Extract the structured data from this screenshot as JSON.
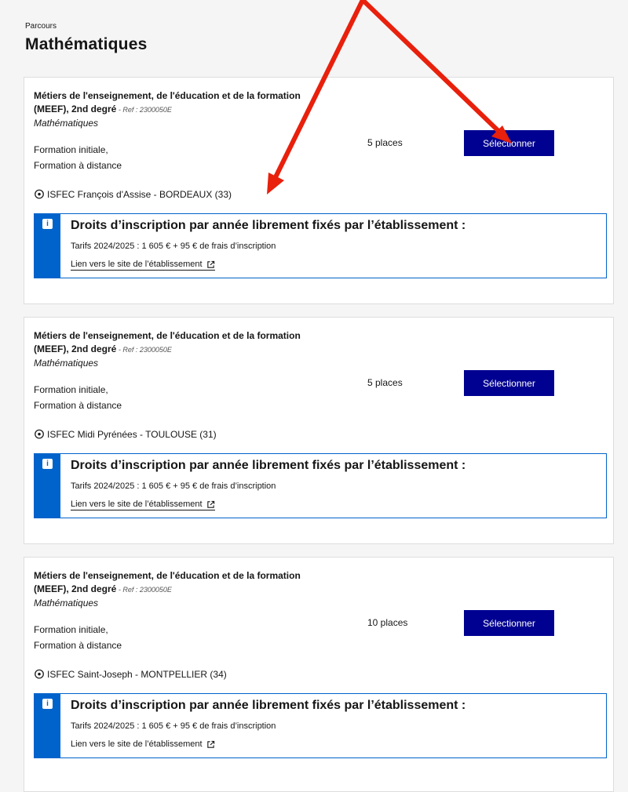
{
  "breadcrumb": "Parcours",
  "page_title": "Mathématiques",
  "colors": {
    "primary_button": "#000091",
    "info_blue": "#0063cb",
    "annotation_red": "#e8200c"
  },
  "cards": [
    {
      "title_line1": "Métiers de l'enseignement, de l'éducation et de la formation",
      "title_line2": "(MEEF), 2nd degré",
      "ref": " - Ref : 2300050E",
      "subject": "Mathématiques",
      "mode1": "Formation initiale,",
      "mode2": "Formation à distance",
      "places": "5 places",
      "select_label": "Sélectionner",
      "location": "ISFEC François d'Assise - BORDEAUX (33)",
      "notice_title": "Droits d’inscription par année librement fixés par l’établissement :",
      "notice_price": "Tarifs 2024/2025 : 1 605 € + 95 € de frais d’inscription",
      "notice_link": "Lien vers le site de l’établissement"
    },
    {
      "title_line1": "Métiers de l'enseignement, de l'éducation et de la formation",
      "title_line2": "(MEEF), 2nd degré",
      "ref": " - Ref : 2300050E",
      "subject": "Mathématiques",
      "mode1": "Formation initiale,",
      "mode2": "Formation à distance",
      "places": "5 places",
      "select_label": "Sélectionner",
      "location": "ISFEC Midi Pyrénées - TOULOUSE (31)",
      "notice_title": "Droits d’inscription par année librement fixés par l’établissement :",
      "notice_price": "Tarifs 2024/2025 : 1 605 € + 95 € de frais d’inscription",
      "notice_link": "Lien vers le site de l’établissement"
    },
    {
      "title_line1": "Métiers de l'enseignement, de l'éducation et de la formation",
      "title_line2": "(MEEF), 2nd degré",
      "ref": " - Ref : 2300050E",
      "subject": "Mathématiques",
      "mode1": "Formation initiale,",
      "mode2": "Formation à distance",
      "places": "10 places",
      "select_label": "Sélectionner",
      "location": "ISFEC Saint-Joseph - MONTPELLIER (34)",
      "notice_title": "Droits d’inscription par année librement fixés par l’établissement :",
      "notice_price": "Tarifs 2024/2025 : 1 605 € + 95 € de frais d’inscription",
      "notice_link": "Lien vers le site de l’établissement"
    }
  ]
}
